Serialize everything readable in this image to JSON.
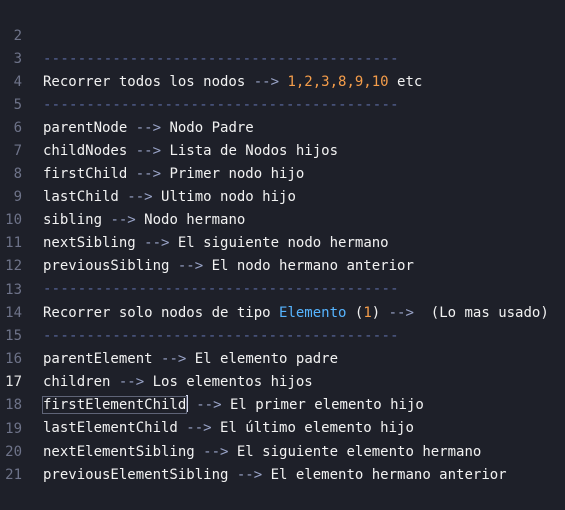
{
  "line_numbers": [
    "2",
    "3",
    "4",
    "5",
    "6",
    "7",
    "8",
    "9",
    "10",
    "11",
    "12",
    "13",
    "14",
    "15",
    "16",
    "17",
    "18",
    "19",
    "20",
    "21"
  ],
  "separator": "-----------------------------------------",
  "arrow": "-->",
  "l3": {
    "text": "Recorrer todos los nodos ",
    "nums": "1,2,3,8,9,10",
    "tail": " etc"
  },
  "l5": {
    "name": "parentNode ",
    "desc": " Nodo Padre"
  },
  "l6": {
    "name": "childNodes ",
    "desc": " Lista de Nodos hijos"
  },
  "l7": {
    "name": "firstChild ",
    "desc": " Primer nodo hijo"
  },
  "l8": {
    "name": "lastChild ",
    "desc": " Ultimo nodo hijo"
  },
  "l9": {
    "name": "sibling ",
    "desc": " Nodo hermano"
  },
  "l10": {
    "name": "nextSibling ",
    "desc": " El siguiente nodo hermano"
  },
  "l11": {
    "name": "previousSibling ",
    "desc": " El nodo hermano anterior"
  },
  "l13": {
    "text": "Recorrer solo nodos de tipo ",
    "kw": "Elemento",
    "open": " (",
    "num": "1",
    "close": ") ",
    "tail": "  (Lo mas usado)"
  },
  "l15": {
    "name": "parentElement ",
    "desc": " El elemento padre"
  },
  "l16": {
    "name": "children ",
    "desc": " Los elementos hijos"
  },
  "l17": {
    "name": "firstElementChild",
    "space": " ",
    "desc": " El primer elemento hijo"
  },
  "l18": {
    "name": "lastElementChild ",
    "desc": " El último elemento hijo"
  },
  "l19": {
    "name": "nextElementSibling ",
    "desc": " El siguiente elemento hermano"
  },
  "l20": {
    "name": "previousElementSibling ",
    "desc": " El elemento hermano anterior"
  },
  "colors": {
    "background": "#1e2029",
    "text": "#f2f2f2",
    "line_number": "#6e7389",
    "separator": "#5b6aa0",
    "number": "#f59d4a",
    "keyword": "#56b4ff"
  }
}
